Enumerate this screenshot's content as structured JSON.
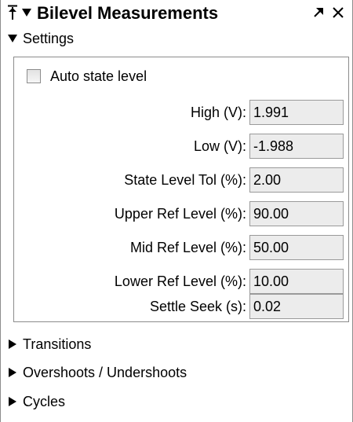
{
  "panel": {
    "title": "Bilevel Measurements",
    "icons": {
      "pin": "pin-icon",
      "collapse": "caret-down-icon",
      "undock": "undock-arrow-icon",
      "close": "close-icon"
    }
  },
  "settings": {
    "label": "Settings",
    "expanded": true,
    "auto_state_level": {
      "label": "Auto state level",
      "checked": false
    },
    "fields": [
      {
        "label": "High (V):",
        "value": "1.991"
      },
      {
        "label": "Low (V):",
        "value": "-1.988"
      },
      {
        "label": "State Level Tol (%):",
        "value": "2.00"
      },
      {
        "label": "Upper Ref Level (%):",
        "value": "90.00"
      },
      {
        "label": "Mid Ref Level (%):",
        "value": "50.00"
      },
      {
        "label": "Lower Ref Level (%):",
        "value": "10.00"
      },
      {
        "label": "Settle Seek (s):",
        "value": "0.02"
      }
    ]
  },
  "sections": [
    {
      "label": "Transitions",
      "expanded": false
    },
    {
      "label": "Overshoots / Undershoots",
      "expanded": false
    },
    {
      "label": "Cycles",
      "expanded": false
    }
  ]
}
